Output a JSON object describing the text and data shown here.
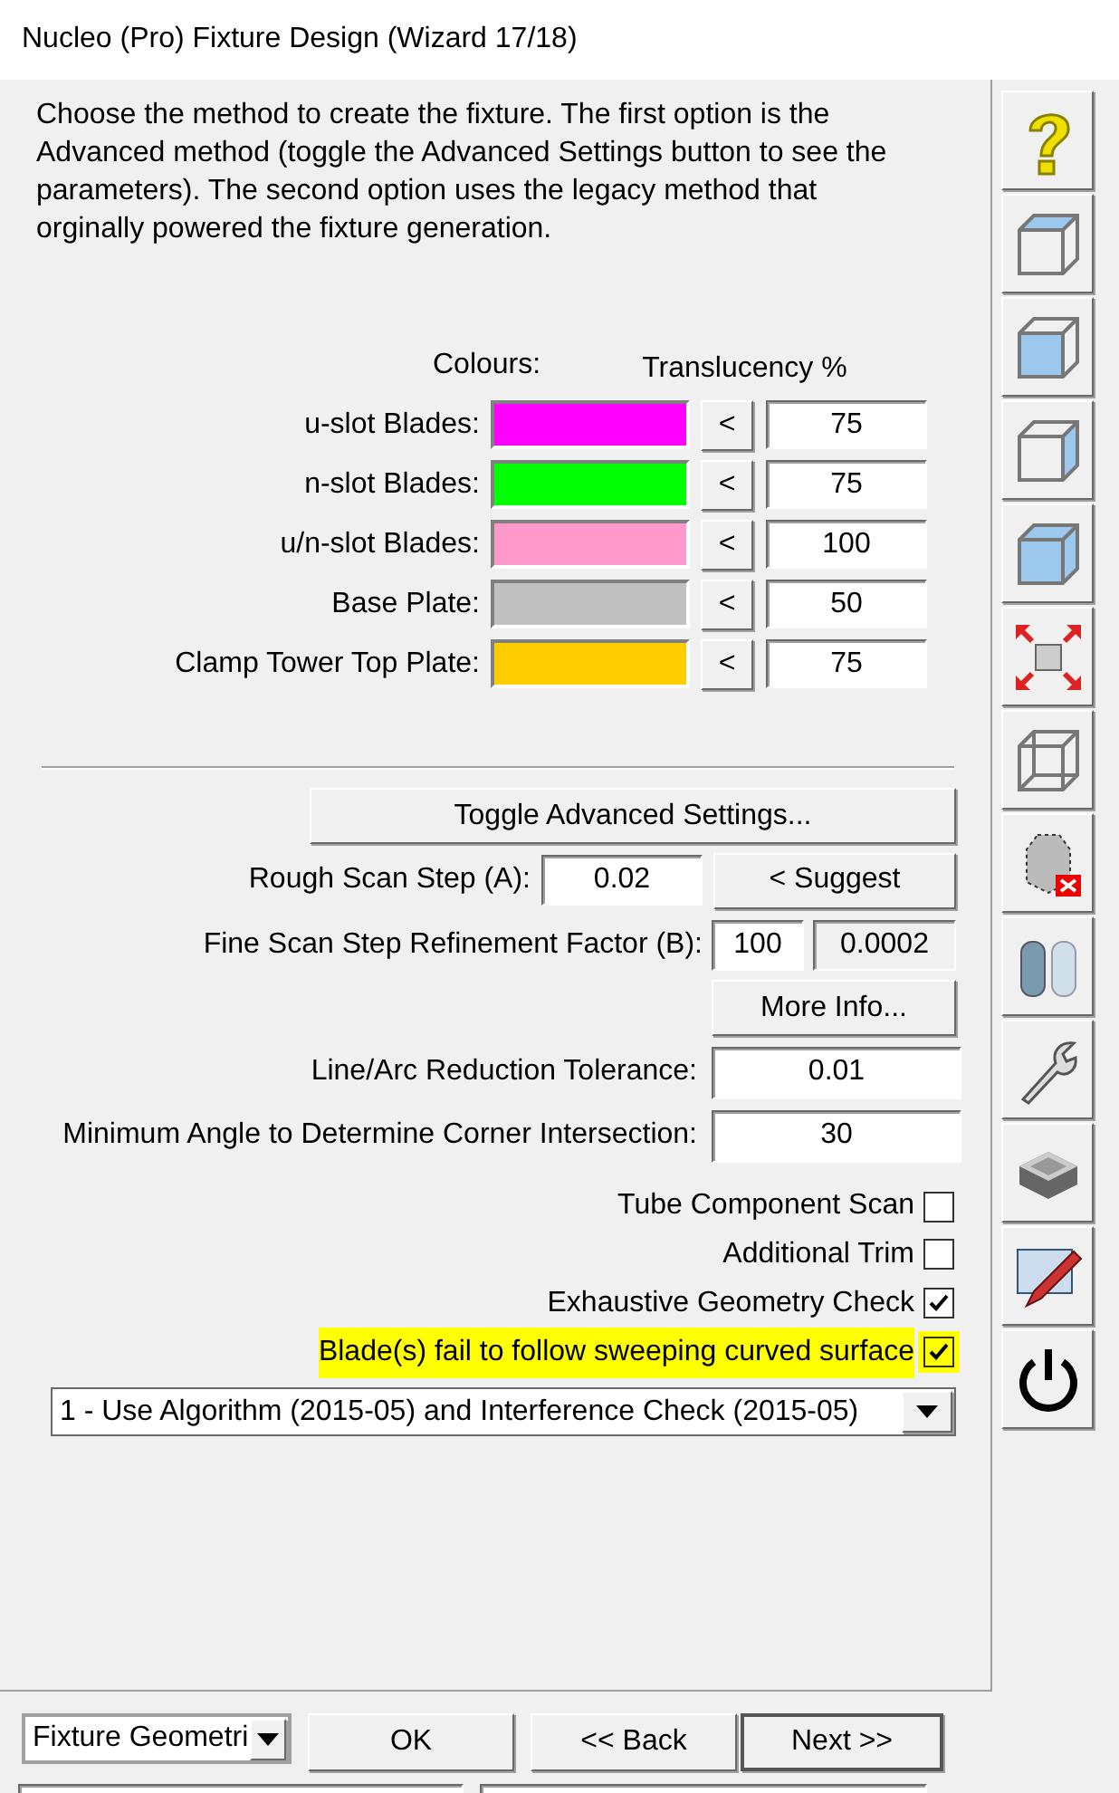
{
  "window": {
    "title": "Nucleo (Pro) Fixture Design (Wizard 17/18)"
  },
  "description": "Choose the method to create the fixture. The first option is the Advanced method (toggle the Advanced Settings button to see the parameters). The second option uses the legacy method that orginally powered the fixture generation.",
  "colours_heading": "Colours:",
  "translucency_heading": "Translucency %",
  "colour_rows": [
    {
      "label": "u-slot Blades:",
      "color": "#ff00ff",
      "button": "<",
      "value": "75"
    },
    {
      "label": "n-slot Blades:",
      "color": "#00ff00",
      "button": "<",
      "value": "75"
    },
    {
      "label": "u/n-slot Blades:",
      "color": "#ff99cc",
      "button": "<",
      "value": "100"
    },
    {
      "label": "Base Plate:",
      "color": "#c0c0c0",
      "button": "<",
      "value": "50"
    },
    {
      "label": "Clamp Tower Top Plate:",
      "color": "#ffcc00",
      "button": "<",
      "value": "75"
    }
  ],
  "toggle_button": "Toggle Advanced Settings...",
  "rough_scan": {
    "label": "Rough Scan Step (A):",
    "value": "0.02",
    "button": "< Suggest"
  },
  "fine_scan": {
    "label": "Fine Scan Step Refinement Factor (B):",
    "value": "100",
    "result": "0.0002"
  },
  "more_info_button": "More Info...",
  "params": [
    {
      "label": "Line/Arc Reduction Tolerance:",
      "value": "0.01"
    },
    {
      "label": "Minimum Angle to Determine Corner Intersection:",
      "value": "30"
    }
  ],
  "checkboxes": [
    {
      "label": "Tube Component Scan",
      "checked": false,
      "highlighted": false
    },
    {
      "label": "Additional Trim",
      "checked": false,
      "highlighted": false
    },
    {
      "label": "Exhaustive Geometry Check",
      "checked": true,
      "highlighted": false
    },
    {
      "label": "Blade(s) fail to follow sweeping curved surface",
      "checked": true,
      "highlighted": true
    }
  ],
  "method_select": {
    "value": "1 - Use Algorithm (2015-05) and Interference Check (2015-05)"
  },
  "toolbar": [
    {
      "kind": "help"
    },
    {
      "kind": "cube-top"
    },
    {
      "kind": "cube-front"
    },
    {
      "kind": "cube-side"
    },
    {
      "kind": "cube-solid"
    },
    {
      "kind": "expand"
    },
    {
      "kind": "wireframe"
    },
    {
      "kind": "mesh"
    },
    {
      "kind": "cylinders"
    },
    {
      "kind": "wrench"
    },
    {
      "kind": "tray"
    },
    {
      "kind": "pencil"
    },
    {
      "kind": "power"
    }
  ],
  "footer": {
    "page_select": "Fixture Geometri",
    "buttons": [
      "OK",
      "<< Back",
      "Next >>"
    ]
  }
}
